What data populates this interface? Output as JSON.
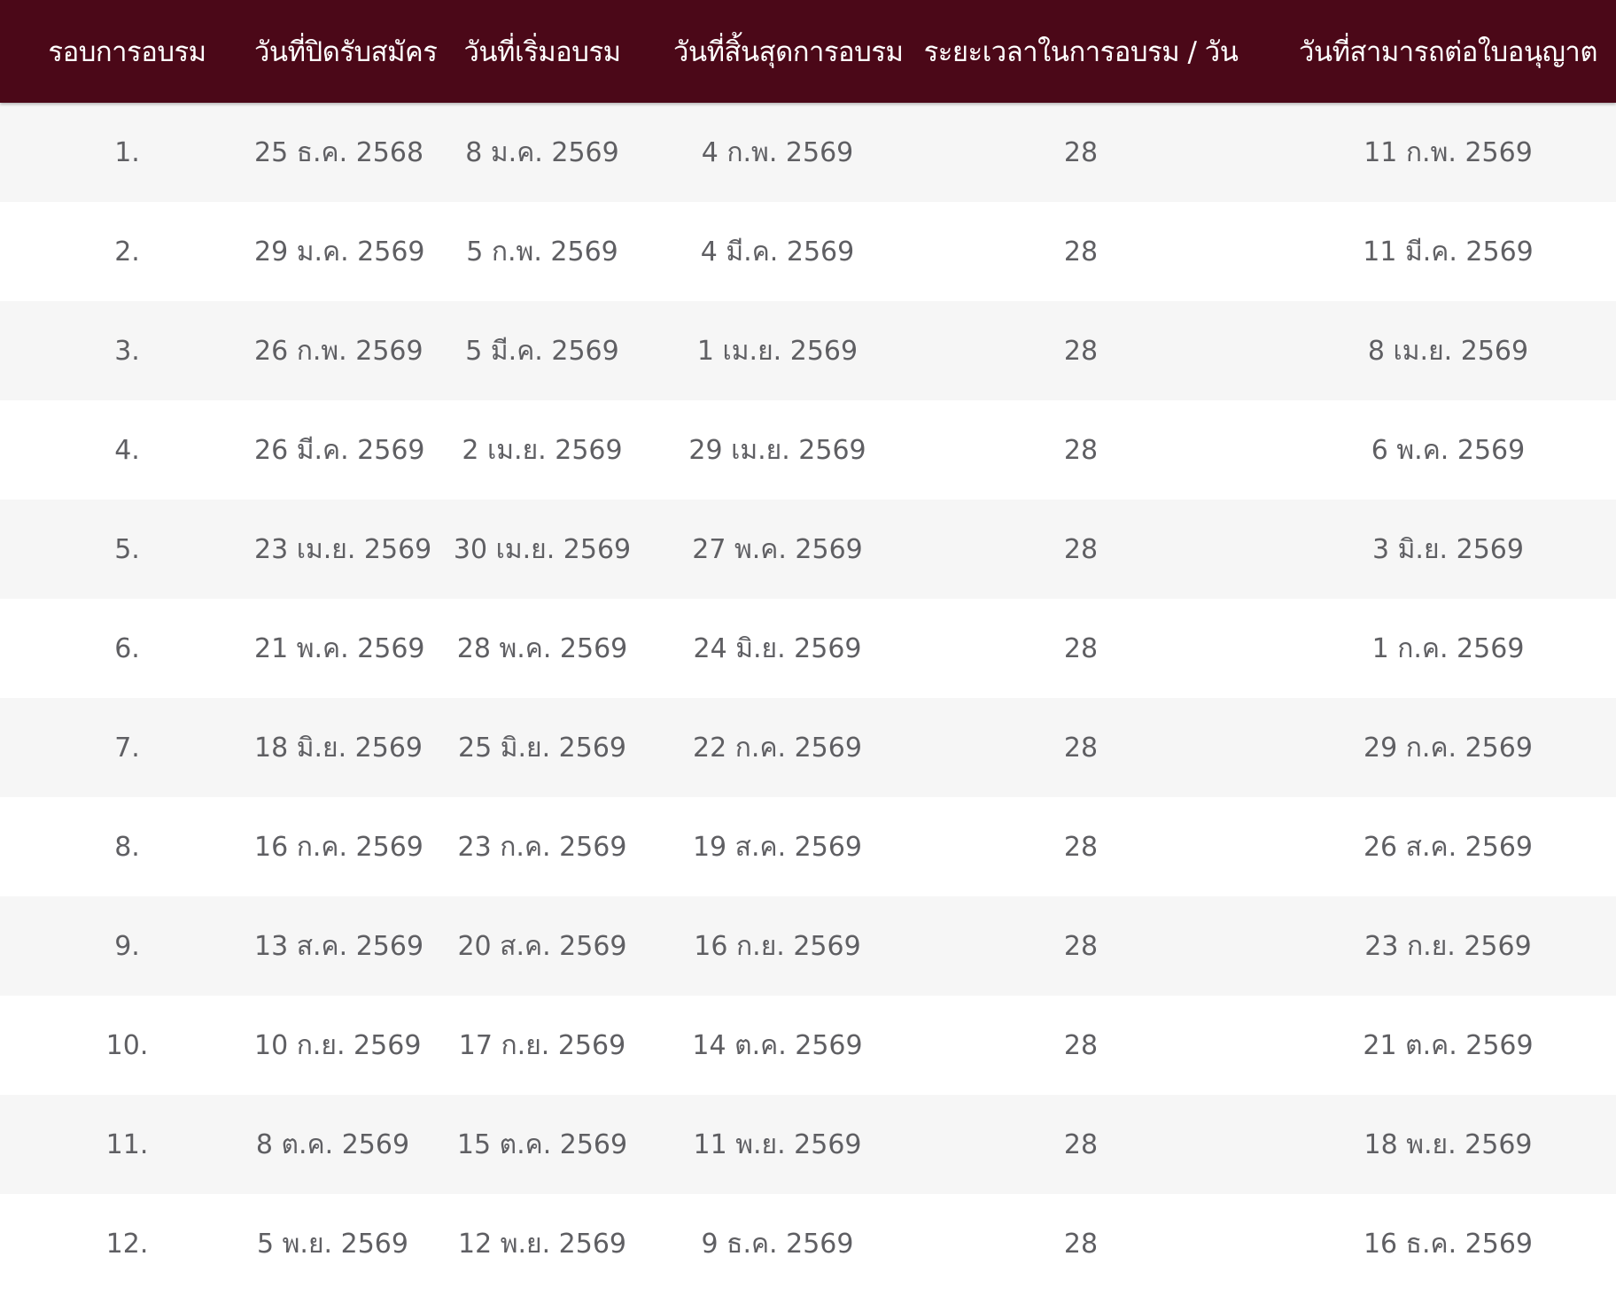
{
  "table": {
    "headers": [
      "รอบการอบรม",
      "วันที่ปิดรับสมัคร",
      "วันที่เริ่มอบรม",
      "วันที่สิ้นสุดการอบรม",
      "ระยะเวลาในการอบรม / วัน",
      "วันที่สามารถต่อใบอนุญาต"
    ],
    "rows": [
      [
        "1.",
        "25 ธ.ค. 2568",
        "8 ม.ค. 2569",
        "4 ก.พ. 2569",
        "28",
        "11 ก.พ. 2569"
      ],
      [
        "2.",
        "29 ม.ค. 2569",
        "5 ก.พ. 2569",
        "4 มี.ค. 2569",
        "28",
        "11 มี.ค. 2569"
      ],
      [
        "3.",
        "26 ก.พ. 2569",
        "5 มี.ค. 2569",
        "1 เม.ย. 2569",
        "28",
        "8 เม.ย. 2569"
      ],
      [
        "4.",
        "26 มี.ค. 2569",
        "2 เม.ย. 2569",
        "29 เม.ย. 2569",
        "28",
        "6 พ.ค. 2569"
      ],
      [
        "5.",
        "23 เม.ย. 2569",
        "30 เม.ย. 2569",
        "27 พ.ค. 2569",
        "28",
        "3 มิ.ย. 2569"
      ],
      [
        "6.",
        "21 พ.ค. 2569",
        "28 พ.ค. 2569",
        "24 มิ.ย. 2569",
        "28",
        "1 ก.ค. 2569"
      ],
      [
        "7.",
        "18 มิ.ย. 2569",
        "25 มิ.ย. 2569",
        "22 ก.ค. 2569",
        "28",
        "29 ก.ค. 2569"
      ],
      [
        "8.",
        "16 ก.ค. 2569",
        "23 ก.ค. 2569",
        "19 ส.ค. 2569",
        "28",
        "26 ส.ค. 2569"
      ],
      [
        "9.",
        "13 ส.ค. 2569",
        "20 ส.ค. 2569",
        "16 ก.ย. 2569",
        "28",
        "23 ก.ย. 2569"
      ],
      [
        "10.",
        "10 ก.ย. 2569",
        "17 ก.ย. 2569",
        "14 ต.ค. 2569",
        "28",
        "21 ต.ค. 2569"
      ],
      [
        "11.",
        "8 ต.ค. 2569",
        "15 ต.ค. 2569",
        "11 พ.ย. 2569",
        "28",
        "18 พ.ย. 2569"
      ],
      [
        "12.",
        "5 พ.ย. 2569",
        "12 พ.ย. 2569",
        "9 ธ.ค. 2569",
        "28",
        "16 ธ.ค. 2569"
      ]
    ]
  },
  "colors": {
    "header_bg": "#4b0818",
    "header_text": "#ffffff",
    "row_alt_bg": "#f6f6f6",
    "row_bg": "#ffffff",
    "cell_text": "#5f5f63"
  }
}
